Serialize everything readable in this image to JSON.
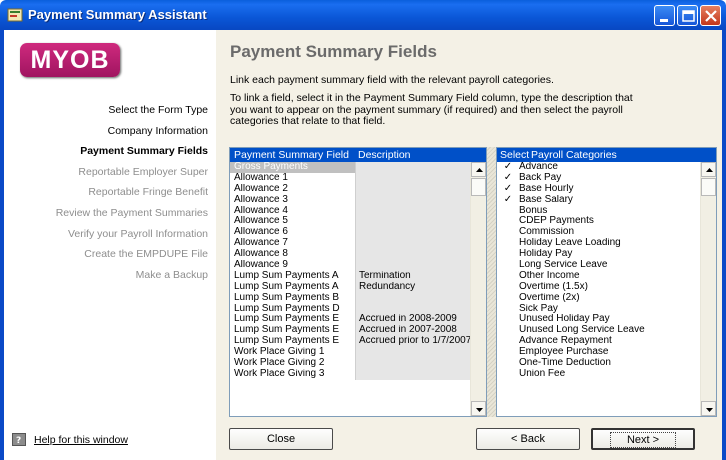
{
  "window": {
    "title": "Payment Summary Assistant",
    "controls": {
      "minimize": "minimize-icon",
      "maximize": "maximize-icon",
      "close": "close-icon"
    }
  },
  "sidebar": {
    "logo": "MYOB",
    "steps": [
      {
        "label": "Select the Form Type",
        "state": "done"
      },
      {
        "label": "Company Information",
        "state": "done"
      },
      {
        "label": "Payment Summary Fields",
        "state": "current"
      },
      {
        "label": "Reportable Employer Super",
        "state": "todo"
      },
      {
        "label": "Reportable Fringe Benefit",
        "state": "todo"
      },
      {
        "label": "Review the Payment Summaries",
        "state": "todo"
      },
      {
        "label": "Verify your Payroll Information",
        "state": "todo"
      },
      {
        "label": "Create the EMPDUPE File",
        "state": "todo"
      },
      {
        "label": "Make a Backup",
        "state": "todo"
      }
    ],
    "help_link": "Help for this window"
  },
  "main": {
    "heading": "Payment Summary Fields",
    "intro": "Link each payment summary field with the relevant payroll categories.",
    "instructions": "To link a field, select it in the Payment Summary Field column, type the description that you want to appear on the payment summary (if required) and then select the payroll categories that relate to that field."
  },
  "fields_list": {
    "headers": [
      "Payment Summary Field",
      "Description"
    ],
    "rows": [
      {
        "field": "Gross Payments",
        "description": "",
        "selected": true
      },
      {
        "field": "Allowance 1",
        "description": ""
      },
      {
        "field": "Allowance 2",
        "description": ""
      },
      {
        "field": "Allowance 3",
        "description": ""
      },
      {
        "field": "Allowance 4",
        "description": ""
      },
      {
        "field": "Allowance 5",
        "description": ""
      },
      {
        "field": "Allowance 6",
        "description": ""
      },
      {
        "field": "Allowance 7",
        "description": ""
      },
      {
        "field": "Allowance 8",
        "description": ""
      },
      {
        "field": "Allowance 9",
        "description": ""
      },
      {
        "field": "Lump Sum Payments A",
        "description": "Termination"
      },
      {
        "field": "Lump Sum Payments A",
        "description": "Redundancy"
      },
      {
        "field": "Lump Sum Payments B",
        "description": ""
      },
      {
        "field": "Lump Sum Payments D",
        "description": ""
      },
      {
        "field": "Lump Sum Payments E",
        "description": "Accrued in 2008-2009"
      },
      {
        "field": "Lump Sum Payments E",
        "description": "Accrued in 2007-2008"
      },
      {
        "field": "Lump Sum Payments E",
        "description": "Accrued prior to 1/7/2007"
      },
      {
        "field": "Work Place Giving 1",
        "description": ""
      },
      {
        "field": "Work Place Giving 2",
        "description": ""
      },
      {
        "field": "Work Place Giving 3",
        "description": ""
      }
    ]
  },
  "categories_list": {
    "headers": [
      "Select",
      "Payroll Categories"
    ],
    "rows": [
      {
        "name": "Advance",
        "checked": true
      },
      {
        "name": "Back Pay",
        "checked": true
      },
      {
        "name": "Base Hourly",
        "checked": true
      },
      {
        "name": "Base Salary",
        "checked": true
      },
      {
        "name": "Bonus",
        "checked": false
      },
      {
        "name": "CDEP Payments",
        "checked": false
      },
      {
        "name": "Commission",
        "checked": false
      },
      {
        "name": "Holiday Leave Loading",
        "checked": false
      },
      {
        "name": "Holiday Pay",
        "checked": false
      },
      {
        "name": "Long Service Leave",
        "checked": false
      },
      {
        "name": "Other Income",
        "checked": false
      },
      {
        "name": "Overtime (1.5x)",
        "checked": false
      },
      {
        "name": "Overtime (2x)",
        "checked": false
      },
      {
        "name": "Sick Pay",
        "checked": false
      },
      {
        "name": "Unused Holiday Pay",
        "checked": false
      },
      {
        "name": "Unused Long Service Leave",
        "checked": false
      },
      {
        "name": "Advance Repayment",
        "checked": false
      },
      {
        "name": "Employee Purchase",
        "checked": false
      },
      {
        "name": "One-Time Deduction",
        "checked": false
      },
      {
        "name": "Union Fee",
        "checked": false
      }
    ],
    "check_glyph": "✓"
  },
  "buttons": {
    "close": "Close",
    "back": "< Back",
    "next": "Next >"
  }
}
